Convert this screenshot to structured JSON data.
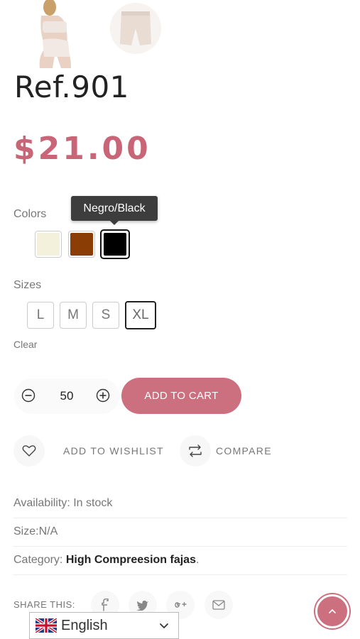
{
  "product": {
    "title": "Ref.901",
    "price": "$21.00"
  },
  "colors": {
    "label": "Colors",
    "tooltip": "Negro/Black",
    "options": [
      {
        "name": "cream",
        "hex": "#f3f1dc"
      },
      {
        "name": "brown",
        "hex": "#8a3e06"
      },
      {
        "name": "Negro/Black",
        "hex": "#000000",
        "selected": true
      }
    ]
  },
  "sizes": {
    "label": "Sizes",
    "options": [
      "L",
      "M",
      "S",
      "XL"
    ],
    "selected": "XL",
    "clear_label": "Clear"
  },
  "cart": {
    "quantity": "50",
    "add_to_cart_label": "ADD TO CART",
    "accent": "#cc6f7f"
  },
  "actions": {
    "wishlist_label": "ADD TO WISHLIST",
    "compare_label": "COMPARE"
  },
  "meta": {
    "availability_label": "Availability:",
    "availability_value": "In stock",
    "size_text": "Size:N/A",
    "category_label": "Category:",
    "category_value": "High Compreesion fajas",
    "category_suffix": "."
  },
  "share": {
    "label": "SHARE THIS:",
    "icons": [
      "facebook-icon",
      "twitter-icon",
      "google-plus-icon",
      "mail-icon"
    ]
  },
  "language": {
    "selected": "English"
  }
}
